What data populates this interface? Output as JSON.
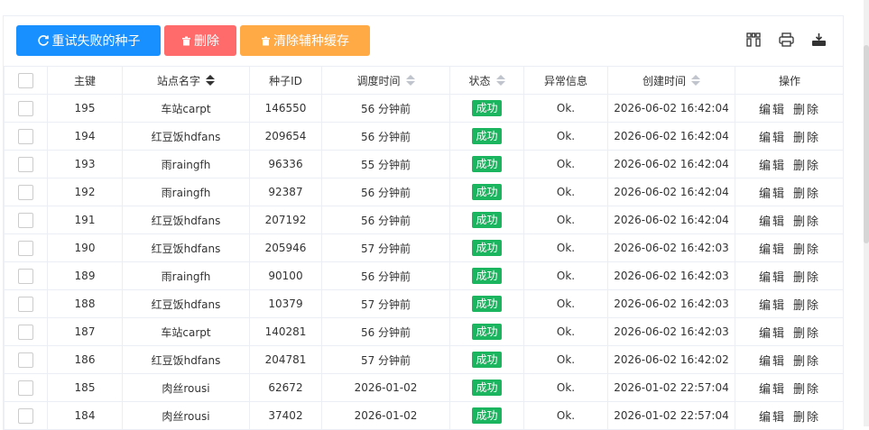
{
  "toolbar": {
    "retry_label": "重试失败的种子",
    "delete_label": "删除",
    "clear_cache_label": "清除辅种缓存"
  },
  "colors": {
    "primary": "#1890ff",
    "danger": "#ff6b6b",
    "warning": "#ffaa45",
    "success": "#1cb55f"
  },
  "tools": [
    "columns-icon",
    "print-icon",
    "export-icon"
  ],
  "table": {
    "headers": {
      "key": "主键",
      "site": "站点名字",
      "seed_id": "种子ID",
      "schedule_time": "调度时间",
      "status": "状态",
      "error": "异常信息",
      "created": "创建时间",
      "actions": "操作"
    },
    "action_edit": "编辑",
    "action_delete": "删除",
    "rows": [
      {
        "key": "195",
        "site": "车站carpt",
        "seed_id": "146550",
        "schedule": "56 分钟前",
        "status": "成功",
        "error": "Ok.",
        "created": "2026-06-02 16:42:04"
      },
      {
        "key": "194",
        "site": "红豆饭hdfans",
        "seed_id": "209654",
        "schedule": "56 分钟前",
        "status": "成功",
        "error": "Ok.",
        "created": "2026-06-02 16:42:04"
      },
      {
        "key": "193",
        "site": "雨raingfh",
        "seed_id": "96336",
        "schedule": "55 分钟前",
        "status": "成功",
        "error": "Ok.",
        "created": "2026-06-02 16:42:04"
      },
      {
        "key": "192",
        "site": "雨raingfh",
        "seed_id": "92387",
        "schedule": "56 分钟前",
        "status": "成功",
        "error": "Ok.",
        "created": "2026-06-02 16:42:04"
      },
      {
        "key": "191",
        "site": "红豆饭hdfans",
        "seed_id": "207192",
        "schedule": "56 分钟前",
        "status": "成功",
        "error": "Ok.",
        "created": "2026-06-02 16:42:04"
      },
      {
        "key": "190",
        "site": "红豆饭hdfans",
        "seed_id": "205946",
        "schedule": "57 分钟前",
        "status": "成功",
        "error": "Ok.",
        "created": "2026-06-02 16:42:03"
      },
      {
        "key": "189",
        "site": "雨raingfh",
        "seed_id": "90100",
        "schedule": "56 分钟前",
        "status": "成功",
        "error": "Ok.",
        "created": "2026-06-02 16:42:03"
      },
      {
        "key": "188",
        "site": "红豆饭hdfans",
        "seed_id": "10379",
        "schedule": "57 分钟前",
        "status": "成功",
        "error": "Ok.",
        "created": "2026-06-02 16:42:03"
      },
      {
        "key": "187",
        "site": "车站carpt",
        "seed_id": "140281",
        "schedule": "56 分钟前",
        "status": "成功",
        "error": "Ok.",
        "created": "2026-06-02 16:42:03"
      },
      {
        "key": "186",
        "site": "红豆饭hdfans",
        "seed_id": "204781",
        "schedule": "57 分钟前",
        "status": "成功",
        "error": "Ok.",
        "created": "2026-06-02 16:42:02"
      },
      {
        "key": "185",
        "site": "肉丝rousi",
        "seed_id": "62672",
        "schedule": "2026-01-02",
        "status": "成功",
        "error": "Ok.",
        "created": "2026-01-02 22:57:04"
      },
      {
        "key": "184",
        "site": "肉丝rousi",
        "seed_id": "37402",
        "schedule": "2026-01-02",
        "status": "成功",
        "error": "Ok.",
        "created": "2026-01-02 22:57:04"
      }
    ]
  }
}
